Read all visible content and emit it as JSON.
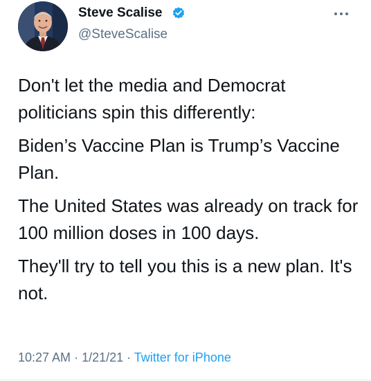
{
  "author": {
    "name": "Steve Scalise",
    "handle": "@SteveScalise",
    "verified": true,
    "avatar_icon": "profile-photo"
  },
  "tweet": {
    "paragraphs": [
      "Don't let the media and Democrat politicians spin this differently:",
      "Biden’s Vaccine Plan is Trump’s Vaccine Plan.",
      "The United States was already on track for 100 million doses in 100 days.",
      "They'll try to tell you this is a new plan. It's not."
    ]
  },
  "meta": {
    "time": "10:27 AM",
    "separator1": " · ",
    "date": "1/21/21",
    "separator2": " · ",
    "source": "Twitter for iPhone"
  },
  "colors": {
    "text": "#0f1419",
    "secondary": "#5b7083",
    "link": "#1da1f2",
    "verified": "#1da1f2"
  },
  "icons": {
    "verified": "verified-badge-icon",
    "more": "more-options-icon"
  }
}
